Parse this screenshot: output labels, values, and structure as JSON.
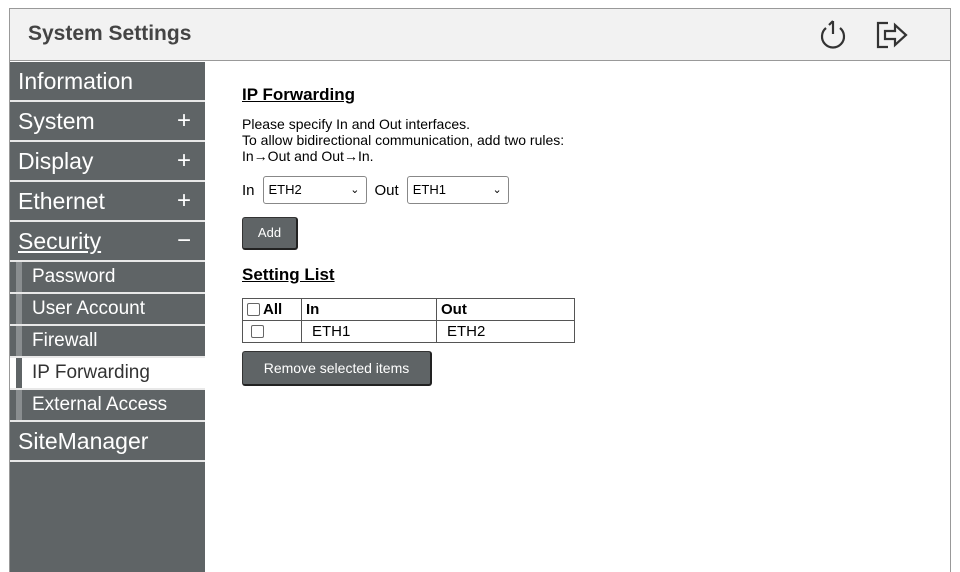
{
  "header": {
    "title": "System Settings",
    "power_icon": "power-icon",
    "logout_icon": "logout-icon"
  },
  "sidebar": {
    "items": [
      {
        "label": "Information",
        "expander": ""
      },
      {
        "label": "System",
        "expander": "+"
      },
      {
        "label": "Display",
        "expander": "+"
      },
      {
        "label": "Ethernet",
        "expander": "+"
      },
      {
        "label": "Security",
        "expander": "−"
      }
    ],
    "security_subitems": [
      {
        "label": "Password"
      },
      {
        "label": "User Account"
      },
      {
        "label": "Firewall"
      },
      {
        "label": "IP Forwarding"
      },
      {
        "label": "External Access"
      }
    ],
    "last_item": {
      "label": "SiteManager"
    },
    "active_subitem": "IP Forwarding"
  },
  "main": {
    "title": "IP Forwarding",
    "desc_line1": "Please specify In and Out interfaces.",
    "desc_line2": "To allow bidirectional communication, add two rules:",
    "desc_line3": "In→Out and Out→In.",
    "in_label": "In",
    "in_value": "ETH2",
    "out_label": "Out",
    "out_value": "ETH1",
    "add_label": "Add",
    "list_title": "Setting List",
    "table": {
      "headers": [
        "All",
        "In",
        "Out"
      ],
      "rows": [
        {
          "checked": false,
          "in": "ETH1",
          "out": "ETH2"
        }
      ]
    },
    "remove_label": "Remove selected items"
  },
  "colors": {
    "sidebar_bg": "#5f6466",
    "header_bg": "#f2f2f2",
    "button_bg": "#5f6466"
  }
}
